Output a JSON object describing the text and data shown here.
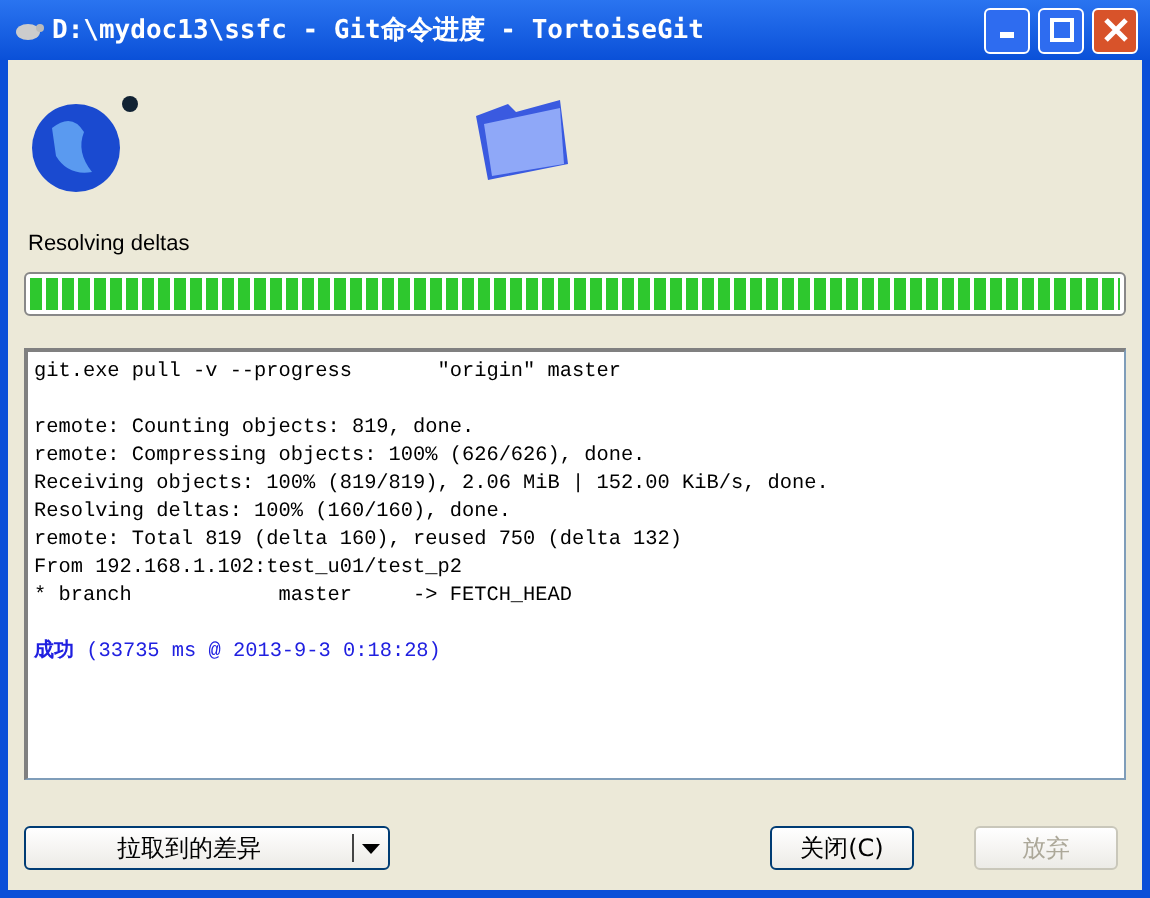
{
  "window": {
    "title": "D:\\mydoc13\\ssfc - Git命令进度 - TortoiseGit"
  },
  "status": {
    "label": "Resolving deltas"
  },
  "progress": {
    "level": 1
  },
  "log": [
    {
      "kind": "command",
      "text": "git.exe pull -v --progress       \"origin\" master"
    },
    {
      "kind": "blank"
    },
    {
      "kind": "normal",
      "text": "remote: Counting objects: 819, done."
    },
    {
      "kind": "normal",
      "text": "remote: Compressing objects: 100% (626/626), done."
    },
    {
      "kind": "normal",
      "text": "Receiving objects: 100% (819/819), 2.06 MiB | 152.00 KiB/s, done."
    },
    {
      "kind": "normal",
      "text": "Resolving deltas: 100% (160/160), done."
    },
    {
      "kind": "normal",
      "text": "remote: Total 819 (delta 160), reused 750 (delta 132)"
    },
    {
      "kind": "normal",
      "text": "From 192.168.1.102:test_u01/test_p2"
    },
    {
      "kind": "normal",
      "text": "* branch            master     -> FETCH_HEAD"
    },
    {
      "kind": "blank"
    },
    {
      "kind": "success",
      "text": "**成功** (33735 ms @ 2013-9-3 0:18:28)"
    }
  ],
  "buttons": {
    "diff": "拉取到的差异",
    "close": "关闭(C)",
    "abort": {
      "label": "放弃",
      "disabled": true
    }
  }
}
